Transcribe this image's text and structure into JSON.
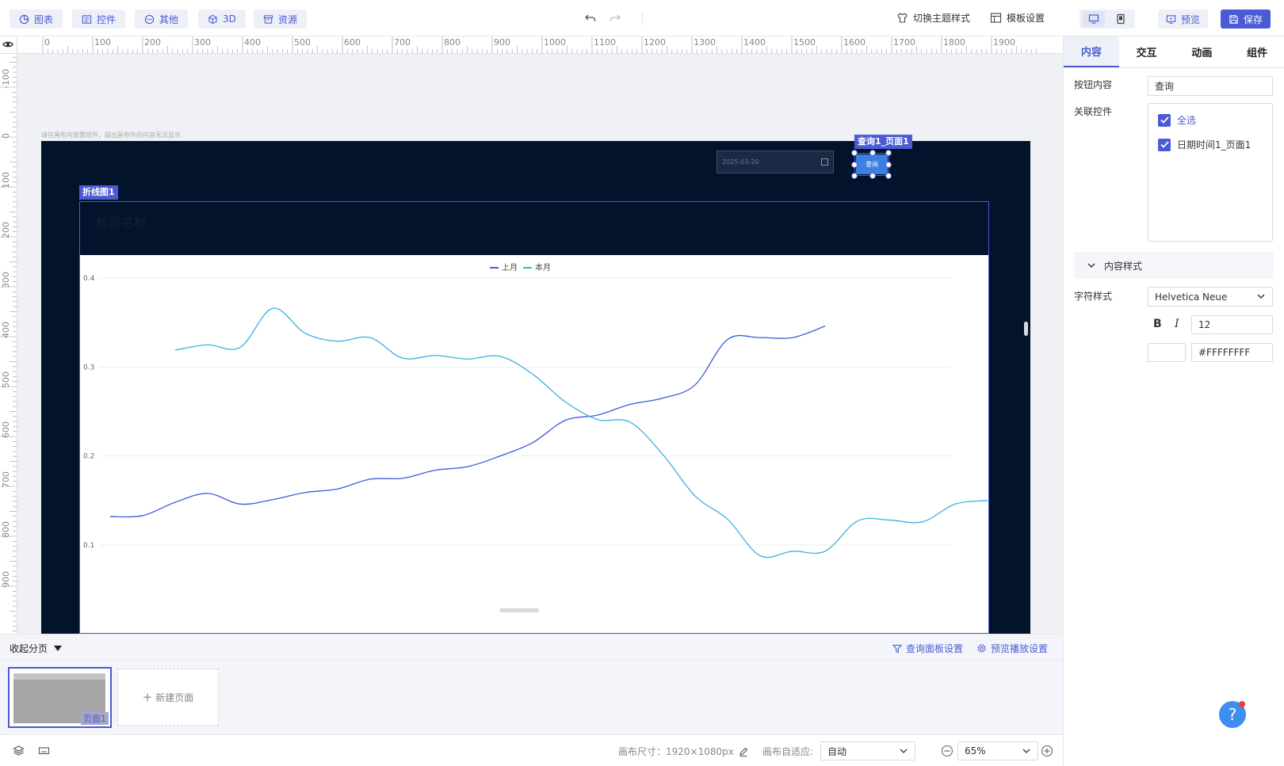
{
  "toolbar": {
    "left_buttons": [
      {
        "label": "图表",
        "icon": "chart-icon"
      },
      {
        "label": "控件",
        "icon": "widget-icon"
      },
      {
        "label": "其他",
        "icon": "more-icon"
      },
      {
        "label": "3D",
        "icon": "cube-icon"
      },
      {
        "label": "资源",
        "icon": "archive-icon"
      }
    ],
    "theme_label": "切换主题样式",
    "template_label": "模板设置",
    "preview_label": "预览",
    "save_label": "保存"
  },
  "ruler": {
    "h_ticks": [
      "0",
      "100",
      "200",
      "300",
      "400",
      "500",
      "600",
      "700",
      "800",
      "900",
      "1000",
      "1100",
      "1200",
      "1300",
      "1400",
      "1500",
      "1600",
      "1700",
      "1800",
      "1900"
    ],
    "v_ticks": [
      "-100",
      "0",
      "100",
      "200",
      "300",
      "400",
      "500",
      "600",
      "700",
      "800",
      "900"
    ]
  },
  "canvas": {
    "hint": "请在画布内放置组件，超出画布外的内容无法显示",
    "date_value": "2025-03-20",
    "query_btn_label": "查询",
    "query_tag": "查询1_页面1",
    "chart_tag": "折线图1",
    "chart_title": "标题名称"
  },
  "chart_data": {
    "type": "line",
    "title": "标题名称",
    "legend": [
      "上月",
      "本月"
    ],
    "y_ticks": [
      0.4,
      0.3,
      0.2,
      0.1
    ],
    "ylim": [
      0.05,
      0.4
    ],
    "grid": true,
    "colors": {
      "上月": "#3b5bdb",
      "本月": "#3bb0e0"
    },
    "series": [
      {
        "name": "上月",
        "color": "#3b5bdb",
        "points": [
          [
            0,
            0.132
          ],
          [
            1,
            0.133
          ],
          [
            2,
            0.148
          ],
          [
            3,
            0.158
          ],
          [
            4,
            0.146
          ],
          [
            5,
            0.151
          ],
          [
            6,
            0.159
          ],
          [
            7,
            0.163
          ],
          [
            8,
            0.174
          ],
          [
            9,
            0.175
          ],
          [
            10,
            0.184
          ],
          [
            11,
            0.188
          ],
          [
            12,
            0.2
          ],
          [
            13,
            0.215
          ],
          [
            14,
            0.24
          ],
          [
            15,
            0.246
          ],
          [
            16,
            0.258
          ],
          [
            17,
            0.265
          ],
          [
            18,
            0.28
          ],
          [
            19,
            0.331
          ],
          [
            20,
            0.333
          ],
          [
            21,
            0.333
          ],
          [
            22,
            0.346
          ]
        ]
      },
      {
        "name": "本月",
        "color": "#3bb0e0",
        "points": [
          [
            2,
            0.319
          ],
          [
            3,
            0.325
          ],
          [
            4,
            0.322
          ],
          [
            5,
            0.366
          ],
          [
            6,
            0.338
          ],
          [
            7,
            0.329
          ],
          [
            8,
            0.333
          ],
          [
            9,
            0.31
          ],
          [
            10,
            0.313
          ],
          [
            11,
            0.309
          ],
          [
            12,
            0.312
          ],
          [
            13,
            0.292
          ],
          [
            14,
            0.261
          ],
          [
            15,
            0.241
          ],
          [
            16,
            0.238
          ],
          [
            17,
            0.202
          ],
          [
            18,
            0.155
          ],
          [
            19,
            0.129
          ],
          [
            20,
            0.088
          ],
          [
            21,
            0.093
          ],
          [
            22,
            0.093
          ],
          [
            23,
            0.127
          ],
          [
            24,
            0.128
          ],
          [
            25,
            0.126
          ],
          [
            26,
            0.146
          ],
          [
            27,
            0.15
          ]
        ]
      }
    ]
  },
  "pages": {
    "collapse_label": "收起分页",
    "query_panel_label": "查询面板设置",
    "preview_play_label": "预览播放设置",
    "page1_label": "页面1",
    "new_page_label": "新建页面"
  },
  "footer": {
    "canvas_size": "画布尺寸：1920×1080px",
    "auto_fit_label": "画布自适应:",
    "auto_fit_value": "自动",
    "zoom_value": "65%"
  },
  "right_panel": {
    "tabs": [
      "内容",
      "交互",
      "动画",
      "组件"
    ],
    "button_content_label": "按钮内容",
    "button_content_value": "查询",
    "linked_label": "关联控件",
    "select_all": "全选",
    "linked_item": "日期时间1_页面1",
    "content_style": "内容样式",
    "font_style_label": "字符样式",
    "font_name": "Helvetica Neue",
    "font_size": "12",
    "color_value": "#FFFFFFFF",
    "bold_glyph": "B",
    "italic_glyph": "I"
  },
  "help": {
    "glyph": "?"
  }
}
